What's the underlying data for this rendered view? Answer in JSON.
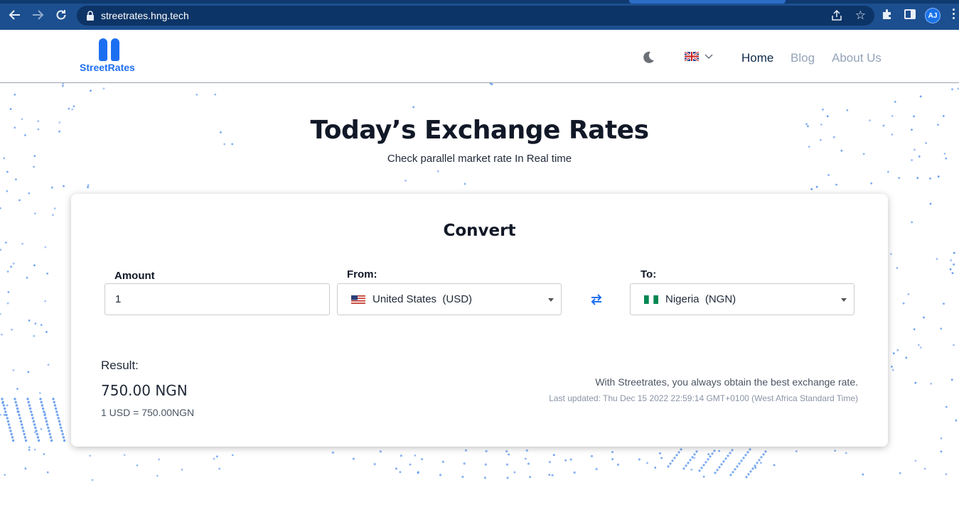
{
  "browser": {
    "url": "streetrates.hng.tech",
    "profile_initials": "AJ"
  },
  "header": {
    "logo_text": "StreetRates",
    "nav": {
      "home": "Home",
      "blog": "Blog",
      "about": "About Us"
    },
    "language_icon": "uk-flag-icon",
    "theme_icon": "moon-icon"
  },
  "hero": {
    "title": "Today’s Exchange Rates",
    "subtitle": "Check parallel market rate In Real time"
  },
  "converter": {
    "title": "Convert",
    "amount_label": "Amount",
    "amount_value": "1",
    "from_label": "From:",
    "from_value": "United States  (USD)",
    "to_label": "To:",
    "to_value": "Nigeria  (NGN)",
    "result_label": "Result:",
    "result_value": "750.00 NGN",
    "rate_line": "1 USD = 750.00NGN",
    "note": "With Streetrates, you always obtain the best exchange rate.",
    "last_updated": "Last updated: Thu Dec 15 2022 22:59:14 GMT+0100 (West Africa Standard Time)"
  },
  "colors": {
    "brand": "#1d6ff2",
    "browser_bar": "#1c4f8f",
    "dot": "#5b95ee"
  }
}
